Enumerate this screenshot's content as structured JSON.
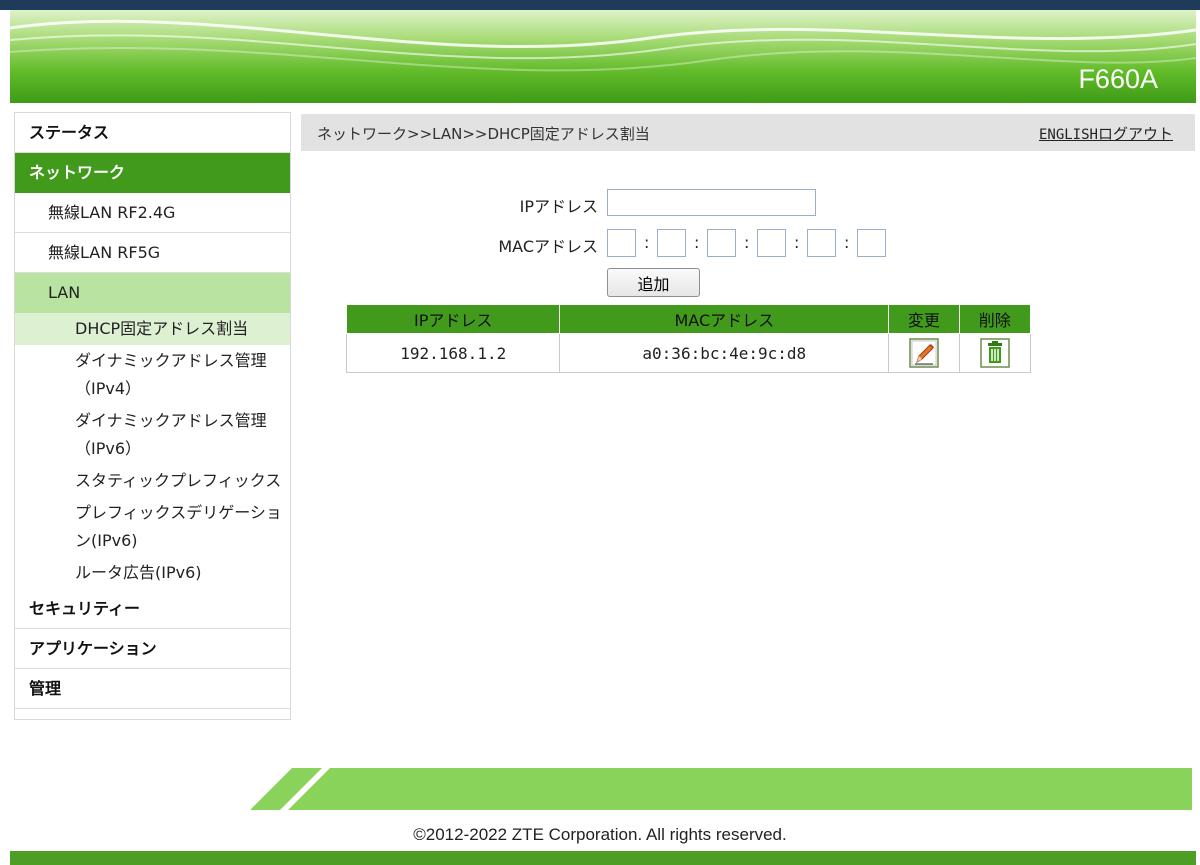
{
  "header": {
    "product": "F660A"
  },
  "sidebar": {
    "items": [
      {
        "label": "ステータス"
      },
      {
        "label": "ネットワーク"
      },
      {
        "label": "無線LAN RF2.4G"
      },
      {
        "label": "無線LAN RF5G"
      },
      {
        "label": "LAN"
      },
      {
        "label": "DHCP固定アドレス割当"
      },
      {
        "label": "ダイナミックアドレス管理（IPv4）"
      },
      {
        "label": "ダイナミックアドレス管理（IPv6）"
      },
      {
        "label": "スタティックプレフィックス"
      },
      {
        "label": "プレフィックスデリゲーション(IPv6)"
      },
      {
        "label": "ルータ広告(IPv6)"
      },
      {
        "label": "セキュリティー"
      },
      {
        "label": "アプリケーション"
      },
      {
        "label": "管理"
      }
    ]
  },
  "content": {
    "breadcrumb": "ネットワーク>>LAN>>DHCP固定アドレス割当",
    "english_link": "ENGLISH",
    "logout_link": "ログアウト"
  },
  "form": {
    "ip_label": "IPアドレス",
    "mac_label": "MACアドレス",
    "ip_value": "",
    "mac_values": [
      "",
      "",
      "",
      "",
      "",
      ""
    ],
    "mac_separator": ":",
    "add_button": "追加"
  },
  "table": {
    "headers": [
      "IPアドレス",
      "MACアドレス",
      "変更",
      "削除"
    ],
    "rows": [
      {
        "ip": "192.168.1.2",
        "mac": "a0:36:bc:4e:9c:d8",
        "edit_icon": "pencil-icon",
        "delete_icon": "trash-icon"
      }
    ]
  },
  "footer": {
    "copyright": "©2012-2022 ZTE Corporation. All rights reserved."
  },
  "colors": {
    "brand_green": "#419a1c",
    "active_sub": "#b9e3a0",
    "footer_green": "#8ad35b"
  }
}
